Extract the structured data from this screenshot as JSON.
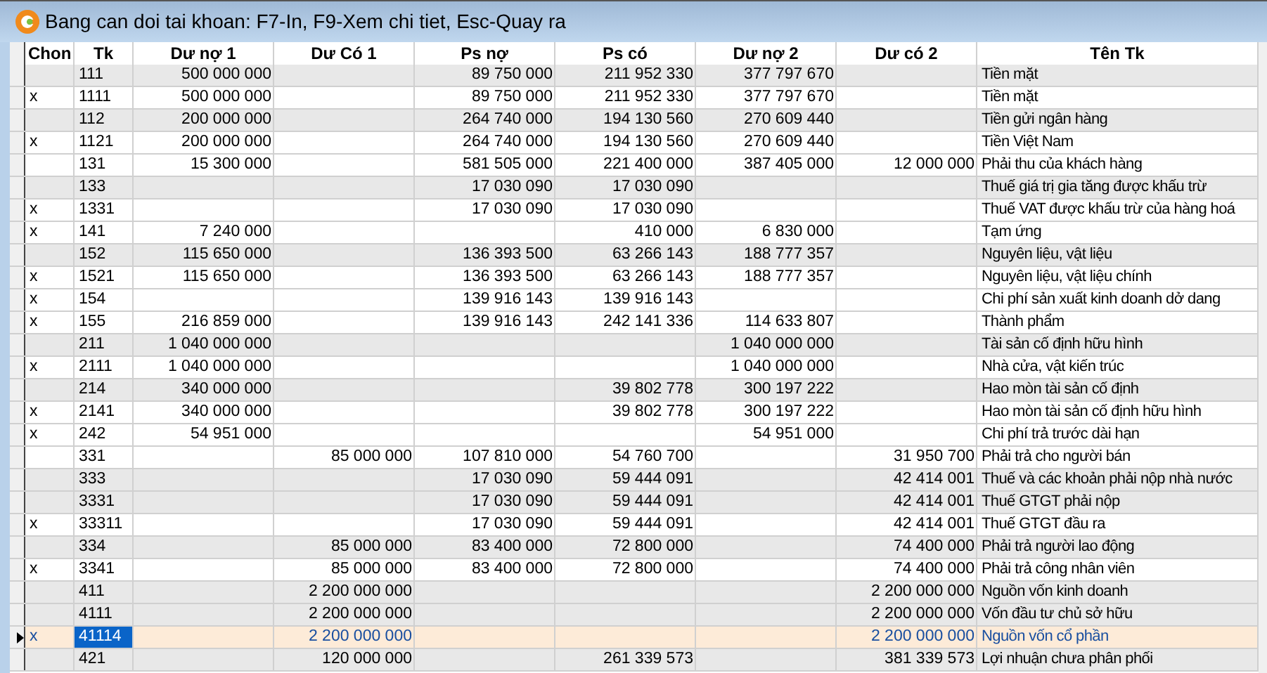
{
  "window": {
    "title": "Bang can doi tai khoan: F7-In, F9-Xem chi tiet, Esc-Quay ra"
  },
  "table": {
    "columns": [
      "Chon",
      "Tk",
      "Dư nợ 1",
      "Dư Có 1",
      "Ps nợ",
      "Ps có",
      "Dư nợ 2",
      "Dư có 2",
      "Tên Tk"
    ],
    "rows": [
      {
        "kind": "group",
        "selected": false,
        "cells": [
          "",
          "111",
          "500 000 000",
          "",
          "89 750 000",
          "211 952 330",
          "377 797 670",
          "",
          "Tiền mặt"
        ]
      },
      {
        "kind": "detail",
        "selected": false,
        "cells": [
          "x",
          "1111",
          "500 000 000",
          "",
          "89 750 000",
          "211 952 330",
          "377 797 670",
          "",
          "Tiền mặt"
        ]
      },
      {
        "kind": "group",
        "selected": false,
        "cells": [
          "",
          "112",
          "200 000 000",
          "",
          "264 740 000",
          "194 130 560",
          "270 609 440",
          "",
          "Tiền gửi ngân hàng"
        ]
      },
      {
        "kind": "detail",
        "selected": false,
        "cells": [
          "x",
          "1121",
          "200 000 000",
          "",
          "264 740 000",
          "194 130 560",
          "270 609 440",
          "",
          "Tiền Việt Nam"
        ]
      },
      {
        "kind": "detail",
        "selected": false,
        "cells": [
          "",
          "131",
          "15 300 000",
          "",
          "581 505 000",
          "221 400 000",
          "387 405 000",
          "12 000 000",
          "Phải thu của khách hàng"
        ]
      },
      {
        "kind": "group",
        "selected": false,
        "cells": [
          "",
          "133",
          "",
          "",
          "17 030 090",
          "17 030 090",
          "",
          "",
          "Thuế giá trị gia tăng được khấu trừ"
        ]
      },
      {
        "kind": "detail",
        "selected": false,
        "cells": [
          "x",
          "1331",
          "",
          "",
          "17 030 090",
          "17 030 090",
          "",
          "",
          "Thuế VAT được khấu trừ của hàng hoá"
        ]
      },
      {
        "kind": "detail",
        "selected": false,
        "cells": [
          "x",
          "141",
          "7 240 000",
          "",
          "",
          "410 000",
          "6 830 000",
          "",
          "Tạm ứng"
        ]
      },
      {
        "kind": "group",
        "selected": false,
        "cells": [
          "",
          "152",
          "115 650 000",
          "",
          "136 393 500",
          "63 266 143",
          "188 777 357",
          "",
          "Nguyên liệu, vật liệu"
        ]
      },
      {
        "kind": "detail",
        "selected": false,
        "cells": [
          "x",
          "1521",
          "115 650 000",
          "",
          "136 393 500",
          "63 266 143",
          "188 777 357",
          "",
          "Nguyên liệu, vật liệu chính"
        ]
      },
      {
        "kind": "detail",
        "selected": false,
        "cells": [
          "x",
          "154",
          "",
          "",
          "139 916 143",
          "139 916 143",
          "",
          "",
          "Chi phí sản xuất kinh doanh dở dang"
        ]
      },
      {
        "kind": "detail",
        "selected": false,
        "cells": [
          "x",
          "155",
          "216 859 000",
          "",
          "139 916 143",
          "242 141 336",
          "114 633 807",
          "",
          "Thành phẩm"
        ]
      },
      {
        "kind": "group",
        "selected": false,
        "cells": [
          "",
          "211",
          "1 040 000 000",
          "",
          "",
          "",
          "1 040 000 000",
          "",
          "Tài sản cố định hữu hình"
        ]
      },
      {
        "kind": "detail",
        "selected": false,
        "cells": [
          "x",
          "2111",
          "1 040 000 000",
          "",
          "",
          "",
          "1 040 000 000",
          "",
          "Nhà cửa, vật kiến trúc"
        ]
      },
      {
        "kind": "group",
        "selected": false,
        "cells": [
          "",
          "214",
          "340 000 000",
          "",
          "",
          "39 802 778",
          "300 197 222",
          "",
          "Hao mòn tài sản cố định"
        ]
      },
      {
        "kind": "detail",
        "selected": false,
        "cells": [
          "x",
          "2141",
          "340 000 000",
          "",
          "",
          "39 802 778",
          "300 197 222",
          "",
          "Hao mòn tài sản cố định hữu hình"
        ]
      },
      {
        "kind": "detail",
        "selected": false,
        "cells": [
          "x",
          "242",
          "54 951 000",
          "",
          "",
          "",
          "54 951 000",
          "",
          "Chi phí trả trước dài hạn"
        ]
      },
      {
        "kind": "detail",
        "selected": false,
        "cells": [
          "",
          "331",
          "",
          "85 000 000",
          "107 810 000",
          "54 760 700",
          "",
          "31 950 700",
          "Phải trả cho người bán"
        ]
      },
      {
        "kind": "group",
        "selected": false,
        "cells": [
          "",
          "333",
          "",
          "",
          "17 030 090",
          "59 444 091",
          "",
          "42 414 001",
          "Thuế và các khoản phải nộp nhà nước"
        ]
      },
      {
        "kind": "group",
        "selected": false,
        "cells": [
          "",
          "3331",
          "",
          "",
          "17 030 090",
          "59 444 091",
          "",
          "42 414 001",
          "Thuế GTGT phải nộp"
        ]
      },
      {
        "kind": "detail",
        "selected": false,
        "cells": [
          "x",
          "33311",
          "",
          "",
          "17 030 090",
          "59 444 091",
          "",
          "42 414 001",
          "Thuế GTGT đầu ra"
        ]
      },
      {
        "kind": "group",
        "selected": false,
        "cells": [
          "",
          "334",
          "",
          "85 000 000",
          "83 400 000",
          "72 800 000",
          "",
          "74 400 000",
          "Phải trả người lao động"
        ]
      },
      {
        "kind": "detail",
        "selected": false,
        "cells": [
          "x",
          "3341",
          "",
          "85 000 000",
          "83 400 000",
          "72 800 000",
          "",
          "74 400 000",
          "Phải trả công nhân viên"
        ]
      },
      {
        "kind": "group",
        "selected": false,
        "cells": [
          "",
          "411",
          "",
          "2 200 000 000",
          "",
          "",
          "",
          "2 200 000 000",
          "Nguồn vốn kinh doanh"
        ]
      },
      {
        "kind": "group",
        "selected": false,
        "cells": [
          "",
          "4111",
          "",
          "2 200 000 000",
          "",
          "",
          "",
          "2 200 000 000",
          "Vốn đầu tư chủ sở hữu"
        ]
      },
      {
        "kind": "detail",
        "selected": true,
        "cells": [
          "x",
          "41114",
          "",
          "2 200 000 000",
          "",
          "",
          "",
          "2 200 000 000",
          "Nguồn vốn cổ phần"
        ]
      },
      {
        "kind": "group",
        "selected": false,
        "cells": [
          "",
          "421",
          "",
          "120 000 000",
          "",
          "261 339 573",
          "",
          "381 339 573",
          "Lợi nhuận chưa phân phối"
        ]
      }
    ]
  }
}
